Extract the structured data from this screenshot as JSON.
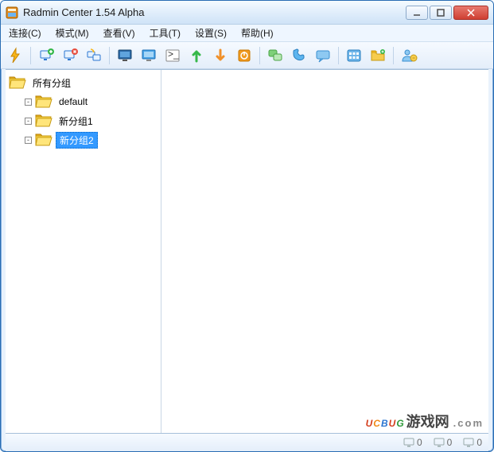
{
  "window": {
    "title": "Radmin Center 1.54 Alpha"
  },
  "menu": {
    "connect": "连接(C)",
    "mode": "模式(M)",
    "view": "查看(V)",
    "tools": "工具(T)",
    "settings": "设置(S)",
    "help": "帮助(H)"
  },
  "tree": {
    "root": "所有分组",
    "children": [
      {
        "label": "default",
        "selected": false
      },
      {
        "label": "新分组1",
        "selected": false
      },
      {
        "label": "新分组2",
        "selected": true
      }
    ]
  },
  "status": {
    "a": "0",
    "b": "0",
    "c": "0"
  },
  "watermark": {
    "brand": "UCBUG",
    "cn": "游戏网",
    "com": ".com"
  }
}
